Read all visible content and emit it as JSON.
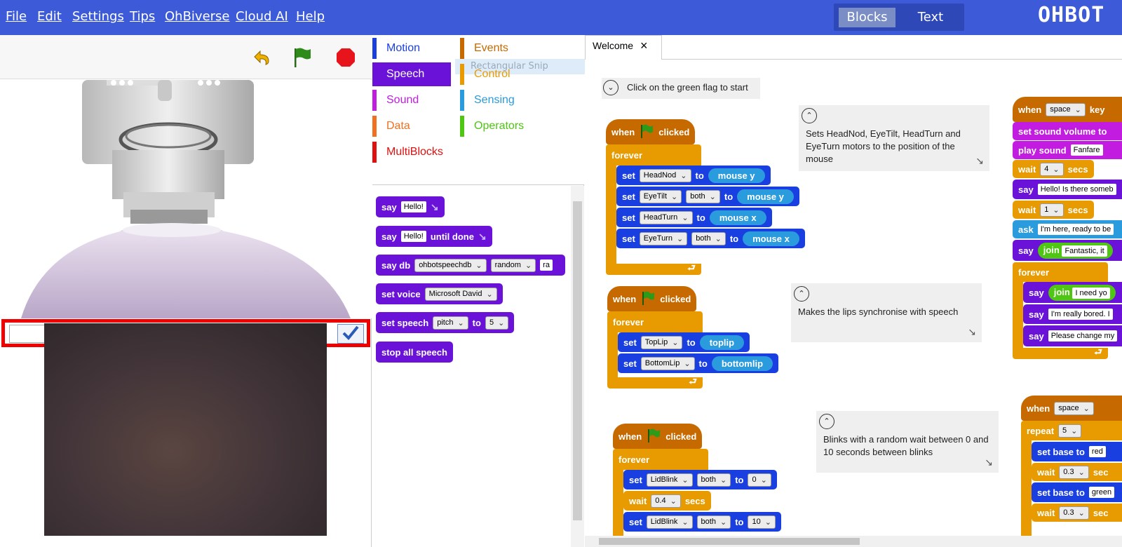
{
  "menu": {
    "items": [
      "File",
      "Edit",
      "Settings",
      "Tips",
      "OhBiverse",
      "Cloud AI",
      "Help"
    ],
    "mode_blocks": "Blocks",
    "mode_text": "Text",
    "logo": "OHBOT"
  },
  "stage": {
    "speech_input_value": "",
    "icons": [
      "undo-icon",
      "green-flag-icon",
      "stop-icon"
    ]
  },
  "palette": {
    "categories_left": [
      {
        "label": "Motion",
        "color": "#1a3fe0"
      },
      {
        "label": "Speech",
        "color": "#6a12d8",
        "selected": true
      },
      {
        "label": "Sound",
        "color": "#c21ce0"
      },
      {
        "label": "Data",
        "color": "#f07020"
      },
      {
        "label": "MultiBlocks",
        "color": "#e01010"
      }
    ],
    "categories_right": [
      {
        "label": "Events",
        "color": "#c66a00"
      },
      {
        "label": "Control",
        "color": "#e89b00"
      },
      {
        "label": "Sensing",
        "color": "#2a9bdc"
      },
      {
        "label": "Operators",
        "color": "#4fc613"
      }
    ],
    "drag_ghost": "Rectangular Snip",
    "blocks": {
      "say": "say",
      "say_hello": "Hello!",
      "until_done": "until done",
      "say_db": "say db",
      "say_db_source": "ohbotspeechdb",
      "say_db_mode": "random",
      "say_db_extra": "ra",
      "set_voice": "set voice",
      "voice_value": "Microsoft David",
      "set_speech": "set speech",
      "speech_param": "pitch",
      "to": "to",
      "speech_value": "5",
      "stop_all": "stop all speech"
    }
  },
  "workspace": {
    "tab_label": "Welcome",
    "intro": "Click on the green flag to start",
    "kw": {
      "when": "when",
      "clicked": "clicked",
      "forever": "forever",
      "set": "set",
      "to": "to",
      "wait": "wait",
      "secs": "secs",
      "repeat": "repeat",
      "say": "say",
      "ask": "ask",
      "join": "join",
      "key": "key",
      "both": "both"
    },
    "script1": {
      "rows": [
        {
          "motor": "HeadNod",
          "to": "mouse y"
        },
        {
          "motor": "EyeTilt",
          "both": true,
          "to": "mouse y"
        },
        {
          "motor": "HeadTurn",
          "to": "mouse x"
        },
        {
          "motor": "EyeTurn",
          "both": true,
          "to": "mouse x"
        }
      ],
      "comment": "Sets HeadNod, EyeTilt, HeadTurn and EyeTurn motors to the position of the mouse"
    },
    "script2": {
      "rows": [
        {
          "motor": "TopLip",
          "to": "toplip"
        },
        {
          "motor": "BottomLip",
          "to": "bottomlip"
        }
      ],
      "comment": "Makes the lips synchronise with speech"
    },
    "script3": {
      "lid": "LidBlink",
      "val1": "0",
      "wait": "0.4",
      "val2": "10",
      "comment": "Blinks with a random wait between 0 and 10 seconds between blinks"
    },
    "script4": {
      "key": "space",
      "set_volume": "set sound volume to",
      "play_sound": "play sound",
      "sound": "Fanfare",
      "wait1": "4",
      "say1": "Hello! Is there someb",
      "wait2": "1",
      "ask": "I'm here, ready to be",
      "join1": "Fantastic, it",
      "join2": "I need yo",
      "say2": "I'm really bored. I",
      "say3": "Please change my"
    },
    "script5": {
      "key": "space",
      "repeat": "5",
      "set_base": "set base to",
      "base1": "red",
      "wait1": "0.3",
      "base2": "green",
      "wait2": "0.3",
      "secs_partial": "sec"
    }
  }
}
